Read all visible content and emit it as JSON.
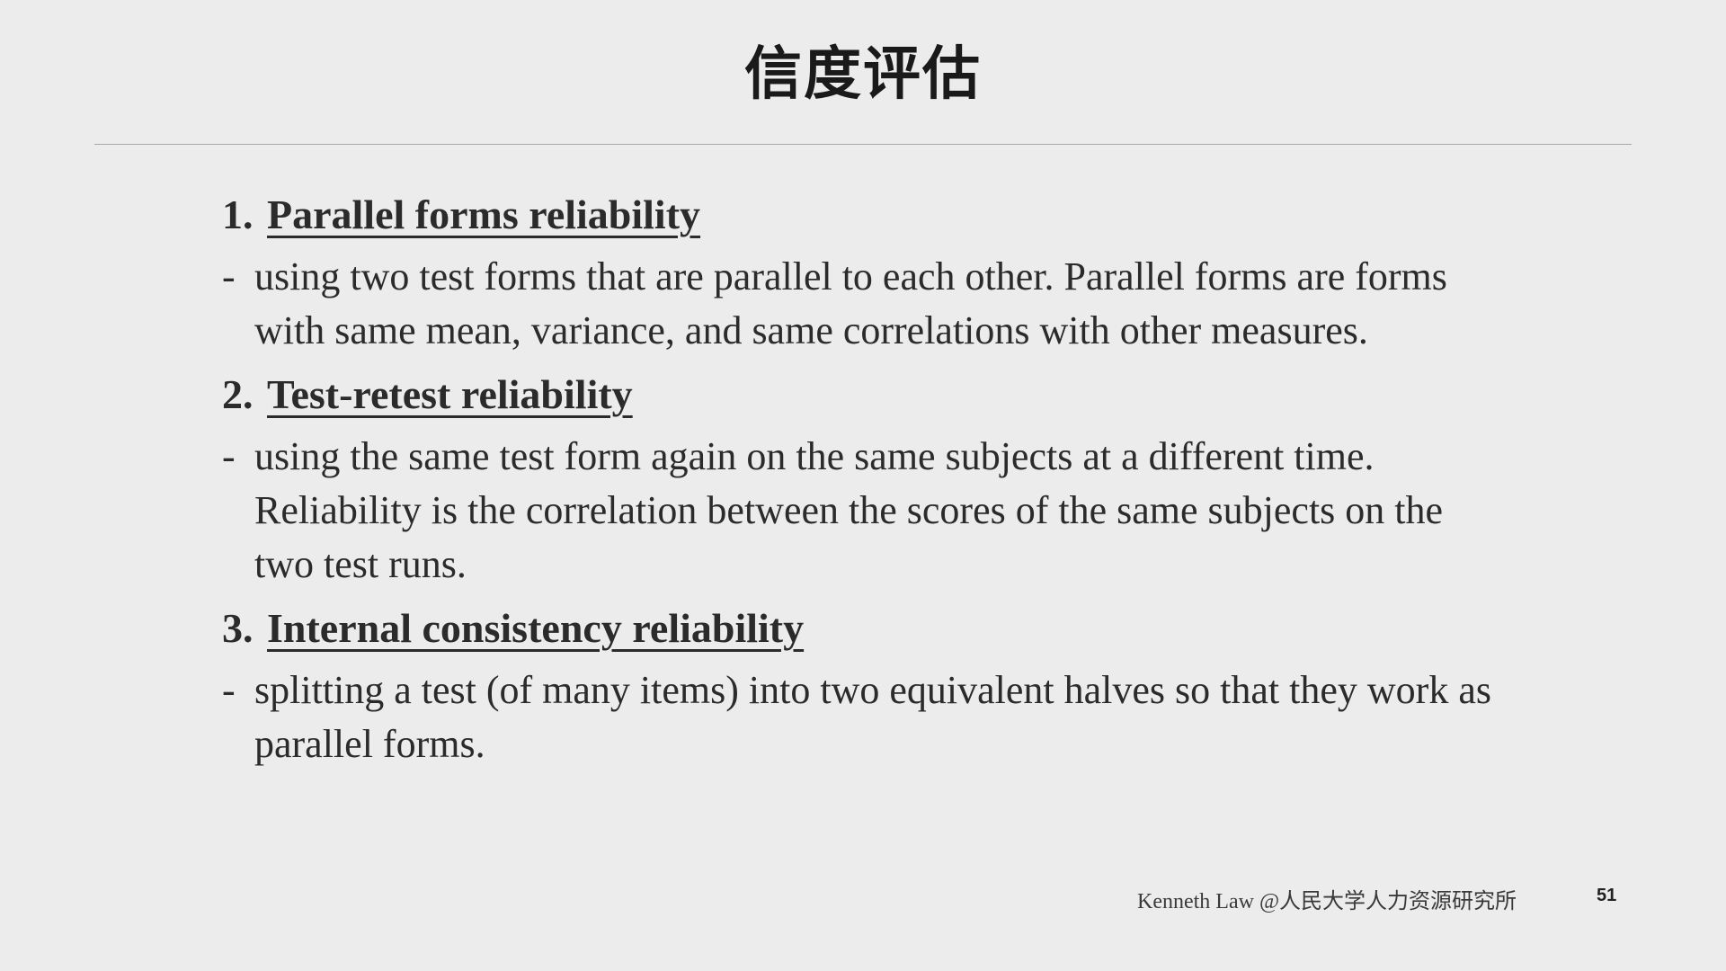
{
  "slide": {
    "title": "信度评估",
    "page_number": "51",
    "footer_credit": "Kenneth Law @人民大学人力资源研究所"
  },
  "items": [
    {
      "number": "1.",
      "heading": "Parallel forms reliability",
      "dash": "-",
      "description": "using two test forms that are parallel to each other.  Parallel forms are forms with same mean, variance, and same correlations with other measures."
    },
    {
      "number": "2.",
      "heading": "Test-retest reliability",
      "dash": "-",
      "description": "using the same test form again on the same subjects at a different time.  Reliability is the correlation between the scores of the same subjects on the two test runs."
    },
    {
      "number": "3.",
      "heading": "Internal consistency reliability",
      "dash": "-",
      "description": "splitting a test (of many items) into two equivalent halves so that they work as parallel forms."
    }
  ]
}
